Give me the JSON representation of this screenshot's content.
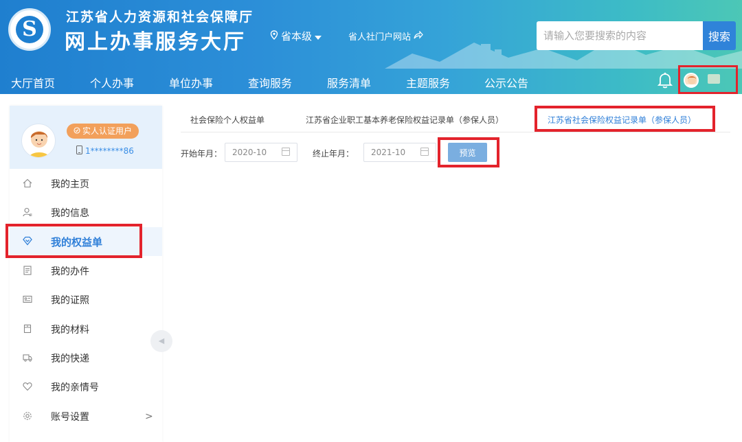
{
  "header": {
    "org_name": "江苏省人力资源和社会保障厅",
    "site_title": "网上办事服务大厅",
    "region": "省本级",
    "portal_link": "省人社门户网站",
    "search_placeholder": "请输入您要搜索的内容",
    "search_button": "搜索",
    "logo_letter": "S"
  },
  "nav": {
    "items": [
      "大厅首页",
      "个人办事",
      "单位办事",
      "查询服务",
      "服务清单",
      "主题服务",
      "公示公告"
    ]
  },
  "user_panel": {
    "verified_badge": "实人认证用户",
    "phone": "1********86"
  },
  "sidebar": {
    "items": [
      {
        "label": "我的主页",
        "icon": "home-icon"
      },
      {
        "label": "我的信息",
        "icon": "user-icon"
      },
      {
        "label": "我的权益单",
        "icon": "diamond-icon",
        "active": true
      },
      {
        "label": "我的办件",
        "icon": "document-icon"
      },
      {
        "label": "我的证照",
        "icon": "id-card-icon"
      },
      {
        "label": "我的材料",
        "icon": "folder-icon"
      },
      {
        "label": "我的快递",
        "icon": "truck-icon"
      },
      {
        "label": "我的亲情号",
        "icon": "heart-icon"
      },
      {
        "label": "账号设置",
        "icon": "gear-icon",
        "chevron": ">"
      }
    ]
  },
  "tabs": [
    {
      "label": "社会保险个人权益单"
    },
    {
      "label": "江苏省企业职工基本养老保险权益记录单（参保人员）"
    },
    {
      "label": "江苏省社会保险权益记录单（参保人员）",
      "active": true
    }
  ],
  "form": {
    "start_label": "开始年月：",
    "start_value": "2020-10",
    "end_label": "终止年月：",
    "end_value": "2021-10",
    "preview_button": "预览"
  },
  "colors": {
    "accent": "#2f7fd8",
    "highlight": "#e3232c",
    "badge": "#f2a05b"
  }
}
